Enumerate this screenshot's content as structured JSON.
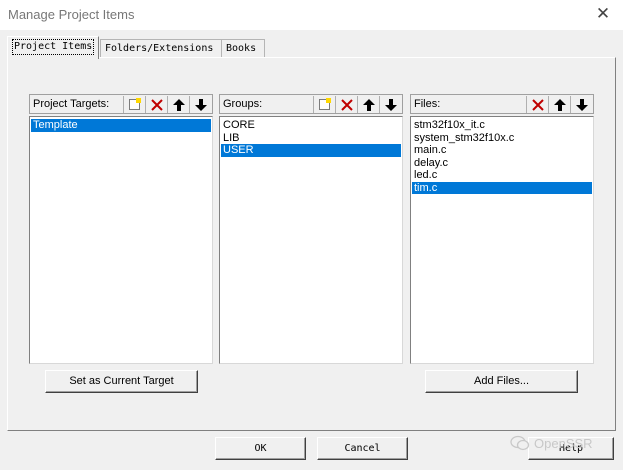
{
  "window": {
    "title": "Manage Project Items",
    "close_glyph": "✕"
  },
  "tabs": [
    {
      "label": "Project Items",
      "active": true
    },
    {
      "label": "Folders/Extensions",
      "active": false
    },
    {
      "label": "Books",
      "active": false
    }
  ],
  "targets": {
    "label": "Project Targets:",
    "items": [
      "Template"
    ],
    "selected": "Template",
    "buttons": [
      "new-icon",
      "delete-icon",
      "move-up-icon",
      "move-down-icon"
    ]
  },
  "groups": {
    "label": "Groups:",
    "items": [
      "CORE",
      "LIB",
      "USER"
    ],
    "selected": "USER",
    "buttons": [
      "new-icon",
      "delete-icon",
      "move-up-icon",
      "move-down-icon"
    ]
  },
  "files": {
    "label": "Files:",
    "items": [
      "stm32f10x_it.c",
      "system_stm32f10x.c",
      "main.c",
      "delay.c",
      "led.c",
      "tim.c"
    ],
    "selected": "tim.c",
    "buttons": [
      "delete-icon",
      "move-up-icon",
      "move-down-icon"
    ]
  },
  "actions": {
    "set_current_target": "Set as Current Target",
    "add_files": "Add Files..."
  },
  "footer": {
    "ok": "OK",
    "cancel": "Cancel",
    "help": "Help"
  },
  "watermark": {
    "text": "OpenSSR"
  },
  "colors": {
    "selection": "#0078d7",
    "delete_red": "#c00000",
    "dialog_bg": "#f0f0f0"
  }
}
